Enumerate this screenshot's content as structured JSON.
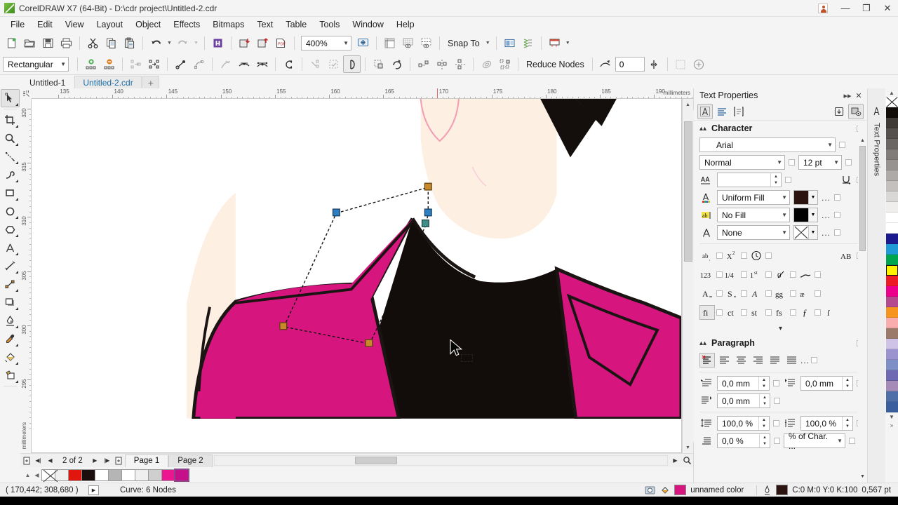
{
  "window": {
    "title": "CorelDRAW X7 (64-Bit) - D:\\cdr project\\Untitled-2.cdr",
    "minimize": "—",
    "restore": "❐",
    "close": "✕"
  },
  "menu": [
    "File",
    "Edit",
    "View",
    "Layout",
    "Object",
    "Effects",
    "Bitmaps",
    "Text",
    "Table",
    "Tools",
    "Window",
    "Help"
  ],
  "standard_toolbar": {
    "zoom_level": "400%",
    "snap_to_label": "Snap To",
    "buttons": [
      "new-document",
      "open-document",
      "save-document",
      "print",
      "cut",
      "copy",
      "paste",
      "undo",
      "redo",
      "corel-connect",
      "import",
      "export",
      "export-to-pdf",
      "zoom-level",
      "full-screen-preview",
      "show-rulers",
      "show-grid",
      "show-guidelines",
      "snap-to",
      "options",
      "application-launcher",
      "workspace"
    ]
  },
  "property_bar": {
    "node_type": "Rectangular",
    "reduce_nodes_label": "Reduce Nodes",
    "reduce_nodes_value": "0"
  },
  "document_tabs": [
    {
      "label": "Untitled-1",
      "active": false
    },
    {
      "label": "Untitled-2.cdr",
      "active": true
    },
    {
      "label": "+",
      "active": false
    }
  ],
  "toolbox": [
    {
      "name": "shape-tool",
      "active": true
    },
    {
      "name": "crop-tool",
      "active": false
    },
    {
      "name": "zoom-tool",
      "active": false
    },
    {
      "name": "freehand-tool",
      "active": false
    },
    {
      "name": "artistic-media-tool",
      "active": false
    },
    {
      "name": "rectangle-tool",
      "active": false
    },
    {
      "name": "ellipse-tool",
      "active": false
    },
    {
      "name": "polygon-tool",
      "active": false
    },
    {
      "name": "text-tool",
      "active": false
    },
    {
      "name": "parallel-dimension-tool",
      "active": false
    },
    {
      "name": "straight-line-connector-tool",
      "active": false
    },
    {
      "name": "drop-shadow-tool",
      "active": false
    },
    {
      "name": "transparency-tool",
      "active": false
    },
    {
      "name": "color-eyedropper-tool",
      "active": false
    },
    {
      "name": "fill-tool",
      "active": false
    },
    {
      "name": "outline-tool",
      "active": false
    }
  ],
  "rulers": {
    "unit": "millimeters",
    "horizontal_ticks": [
      "135",
      "140",
      "145",
      "150",
      "155",
      "160",
      "165",
      "170",
      "175",
      "180",
      "185",
      "190"
    ],
    "vertical_ticks": [
      "320",
      "315",
      "310",
      "305",
      "300",
      "295"
    ]
  },
  "docker": {
    "title": "Text Properties",
    "side_label": "Text Properties",
    "collapse": "▸▸",
    "close": "✕",
    "sections": {
      "character": {
        "title": "Character",
        "font": "Arial",
        "style": "Normal",
        "size": "12 pt",
        "kerning": "",
        "fill_type": "Uniform Fill",
        "fill_color": "#2b1410",
        "background_fill": "No Fill",
        "background_color": "#000000",
        "outline": "None",
        "ellipsis": "..."
      },
      "paragraph": {
        "title": "Paragraph",
        "first_line_indent": "0,0 mm",
        "left_indent": "0,0 mm",
        "right_indent": "0,0 mm",
        "line_spacing": "100,0 %",
        "paragraph_spacing": "100,0 %",
        "character_spacing": "0,0 %",
        "spacing_units": "% of Char. ...",
        "ellipsis": "..."
      }
    }
  },
  "page_navigator": {
    "page_count": "2 of 2",
    "pages": [
      {
        "label": "Page 1",
        "active": true
      },
      {
        "label": "Page 2",
        "active": false
      }
    ]
  },
  "status_bar": {
    "coordinates": "( 170,442; 308,680 )",
    "object_info": "Curve: 6 Nodes",
    "fill_color_name": "unnamed color",
    "fill_swatch": "#d6157f",
    "outline_color": "C:0 M:0 Y:0 K:100",
    "outline_width": "0,567 pt",
    "outline_swatch": "#2b1410"
  },
  "artwork": {
    "skin_color": "#fdf0e3",
    "jacket_color": "#d6157f",
    "top_color": "#120c0a",
    "line_color": "#1a1412",
    "skin_line_color": "#f4a0b4"
  },
  "color_palette": [
    "none",
    "#130d0a",
    "#403a37",
    "#55504d",
    "#6b6663",
    "#817c79",
    "#979390",
    "#adaaa7",
    "#c3c0be",
    "#d9d7d5",
    "#efeeed",
    "#ffffff",
    "#ffffff",
    "#1b1b8f",
    "#1e9ad6",
    "#00a550",
    "#fff200",
    "#ed1c24",
    "#ec008c",
    "#b54a8e",
    "#f7941e",
    "#f9adad",
    "#9b7a6a",
    "#cfc4e8",
    "#9a93cf",
    "#7d8fc4",
    "#6e69b2",
    "#a58bb8",
    "#4f6fa8",
    "#3a5e9e"
  ],
  "document_palette": [
    "none",
    "#efefef",
    "#e0160f",
    "#1a0f0c",
    "#ffffff",
    "#b5b5b5",
    "#ffffff",
    "#efefef",
    "#cfcfcf",
    "#ec1790",
    "#c5108a"
  ]
}
